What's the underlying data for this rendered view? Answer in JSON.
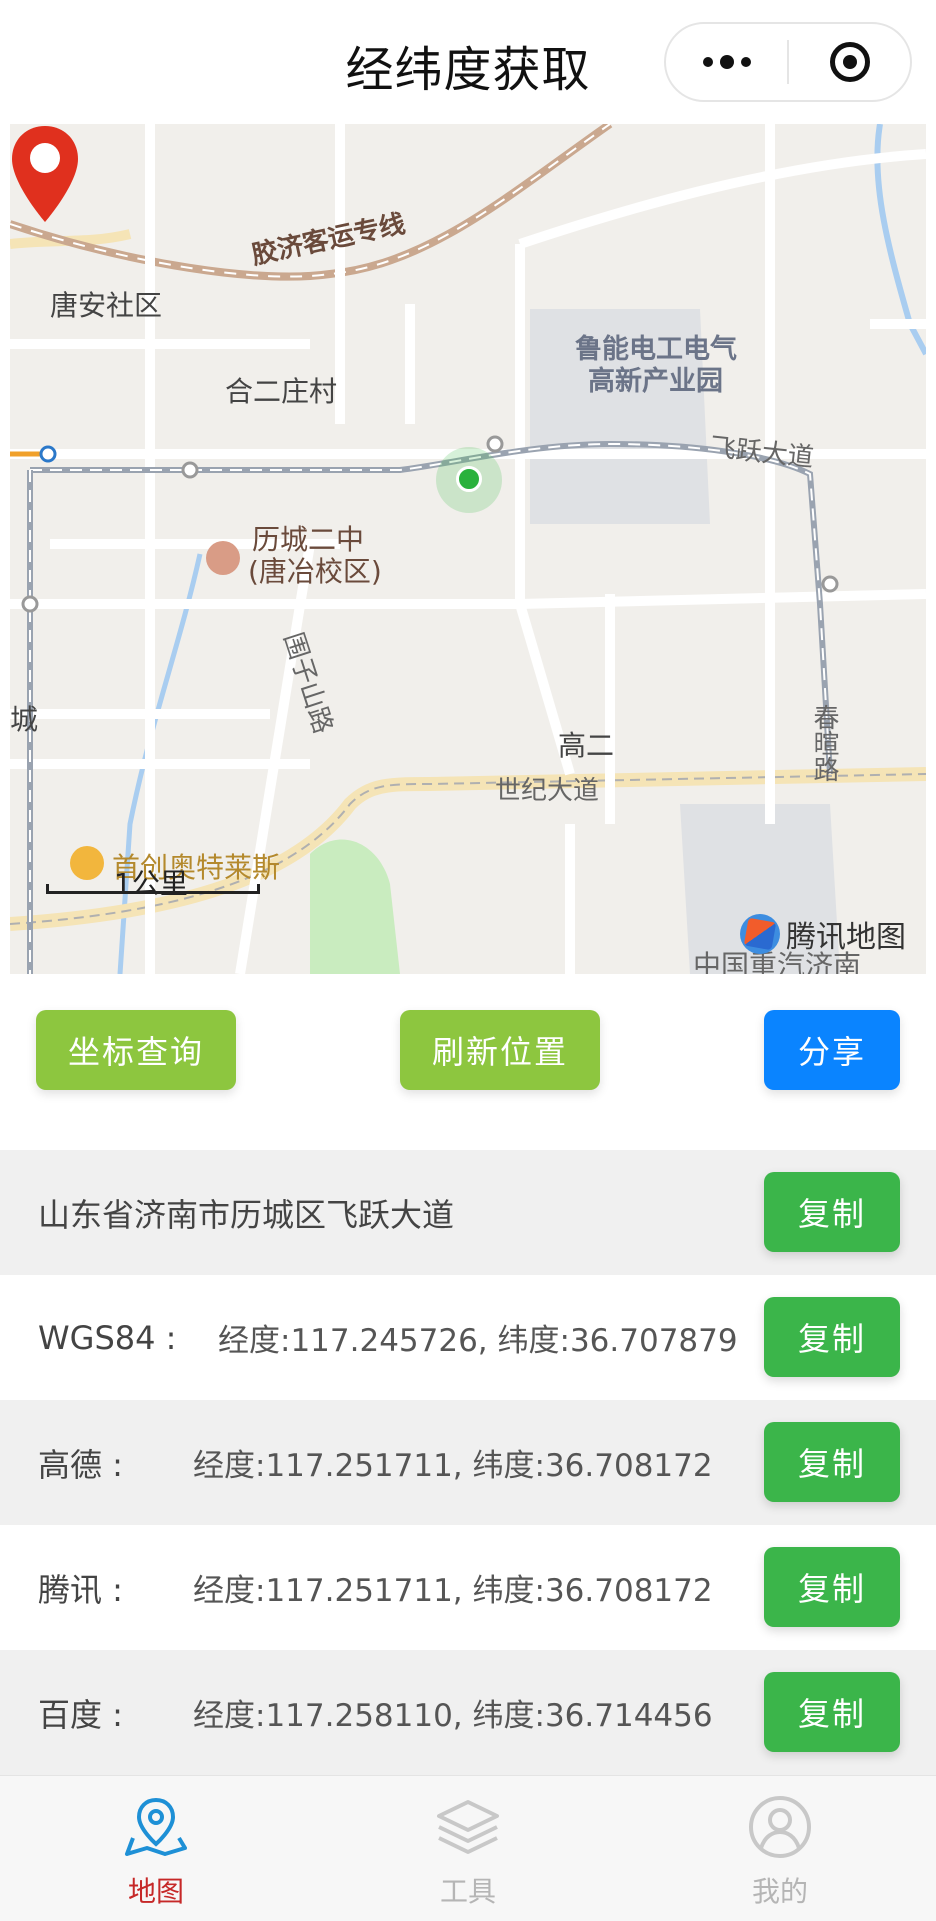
{
  "header": {
    "title": "经纬度获取",
    "capsule_icons": [
      "more-dots-icon",
      "close-target-icon"
    ]
  },
  "map": {
    "labels": {
      "railway": "胶济客运专线",
      "tangan": "唐安社区",
      "heer": "合二庄村",
      "park1": "鲁能电工电气",
      "park2": "高新产业园",
      "feiyue": "飞跃大道",
      "school1": "历城二中",
      "school2": "(唐冶校区)",
      "weizishan": "围子山路",
      "cheng": "城",
      "gaoer": "高二",
      "chunxuan": "春暄路",
      "shiji": "世纪大道",
      "outlets": "首创奥特莱斯",
      "bottom": "中国重汽济南"
    },
    "scale": "1公里",
    "logo": "腾讯地图"
  },
  "actions": {
    "query": "坐标查询",
    "refresh": "刷新位置",
    "share": "分享"
  },
  "rows": [
    {
      "label": "山东省济南市历城区飞跃大道",
      "value": "",
      "copy": "复制"
    },
    {
      "label": "WGS84 :",
      "value": "经度:117.245726, 纬度:36.707879",
      "copy": "复制"
    },
    {
      "label": "高德 :",
      "value": "经度:117.251711, 纬度:36.708172",
      "copy": "复制"
    },
    {
      "label": "腾讯 :",
      "value": "经度:117.251711, 纬度:36.708172",
      "copy": "复制"
    },
    {
      "label": "百度 :",
      "value": "经度:117.258110, 纬度:36.714456",
      "copy": "复制"
    }
  ],
  "tabbar": {
    "tabs": [
      {
        "label": "地图",
        "icon": "map-pin-icon",
        "active": true
      },
      {
        "label": "工具",
        "icon": "layers-icon",
        "active": false
      },
      {
        "label": "我的",
        "icon": "user-icon",
        "active": false
      }
    ]
  },
  "colors": {
    "primary_green": "#3bb54a",
    "light_green": "#8dc63f",
    "blue": "#0a84ff",
    "active_tab": "#c62828"
  }
}
